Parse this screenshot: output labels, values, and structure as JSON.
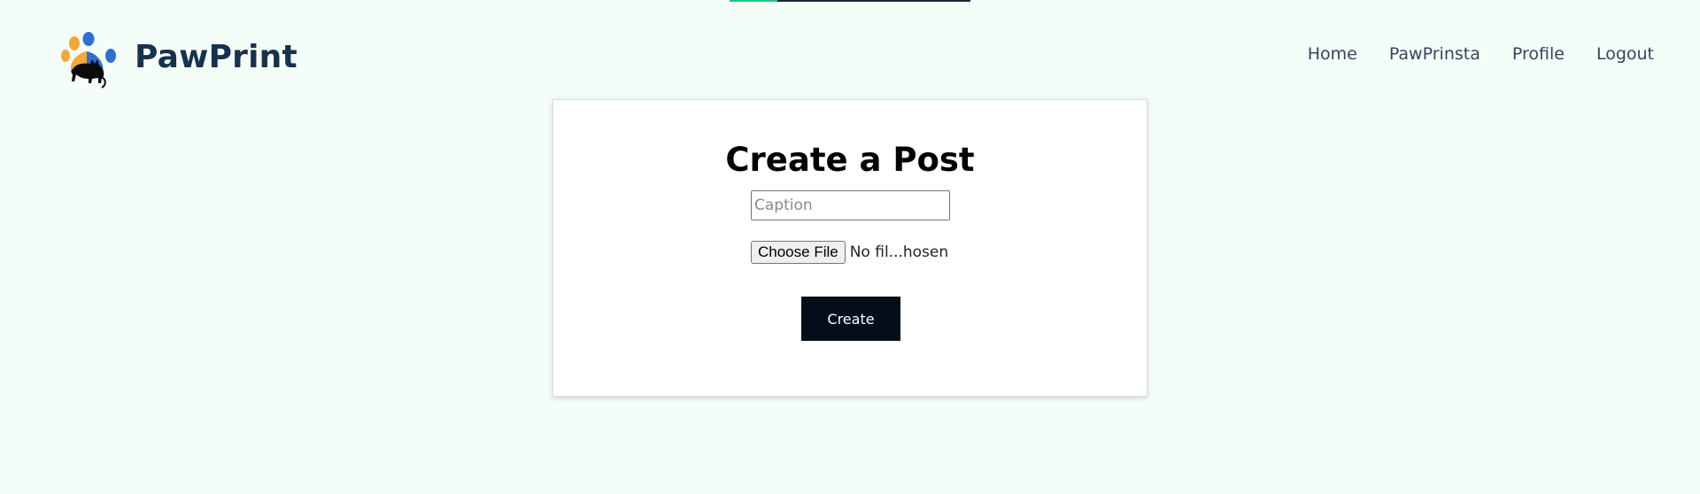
{
  "loading_bar": {
    "progress": 0.2,
    "fill_color": "#16c784",
    "track_color": "#1f2937"
  },
  "header": {
    "brand_name": "PawPrint",
    "logo_icon": "paw-print-cat-logo-icon",
    "nav": [
      {
        "label": "Home"
      },
      {
        "label": "PawPrinsta"
      },
      {
        "label": "Profile"
      },
      {
        "label": "Logout"
      }
    ]
  },
  "create_post": {
    "title": "Create a Post",
    "caption_placeholder": "Caption",
    "caption_value": "",
    "file_button_label": "Choose File",
    "file_status": "No fil...hosen",
    "submit_label": "Create"
  },
  "colors": {
    "page_background": "#f4fdf8",
    "brand_text": "#17324d",
    "nav_text": "#33465a",
    "submit_button": "#050c1a"
  }
}
